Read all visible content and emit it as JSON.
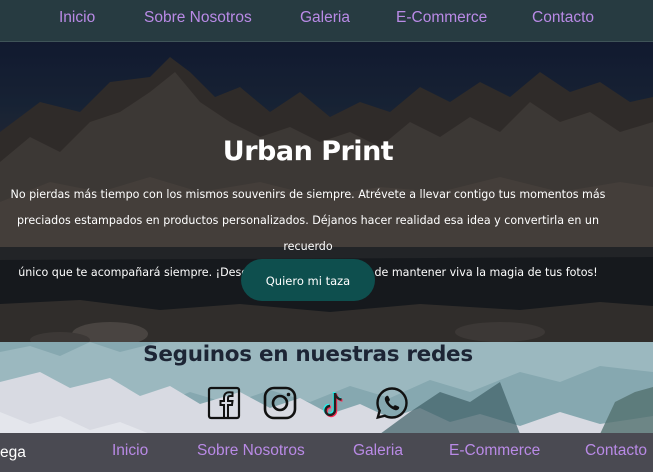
{
  "nav": {
    "items": [
      {
        "label": "Inicio"
      },
      {
        "label": "Sobre Nosotros"
      },
      {
        "label": "Galeria"
      },
      {
        "label": "E-Commerce"
      },
      {
        "label": "Contacto"
      }
    ]
  },
  "hero": {
    "title": "Urban Print",
    "description_lines": [
      "No pierdas más tiempo con los mismos souvenirs de siempre. Atrévete a llevar contigo tus momentos más",
      "preciados estampados en productos personalizados. Déjanos hacer realidad esa idea y convertirla en un recuerdo",
      "único que te acompañará siempre. ¡Descubre una nueva forma de mantener viva la magia de tus fotos!"
    ],
    "cta_label": "Quiero mi taza"
  },
  "social": {
    "title": "Seguinos en nuestras redes",
    "icons": [
      "facebook-icon",
      "instagram-icon",
      "tiktok-icon",
      "whatsapp-icon"
    ]
  },
  "footer": {
    "brand": "ega",
    "items": [
      {
        "label": "Inicio"
      },
      {
        "label": "Sobre Nosotros"
      },
      {
        "label": "Galeria"
      },
      {
        "label": "E-Commerce"
      },
      {
        "label": "Contacto"
      }
    ]
  },
  "colors": {
    "nav_bg": "#273b41",
    "nav_link": "#b98ae6",
    "cta_bg": "#0e4f4e",
    "footer_bg": "#4a4a52"
  }
}
